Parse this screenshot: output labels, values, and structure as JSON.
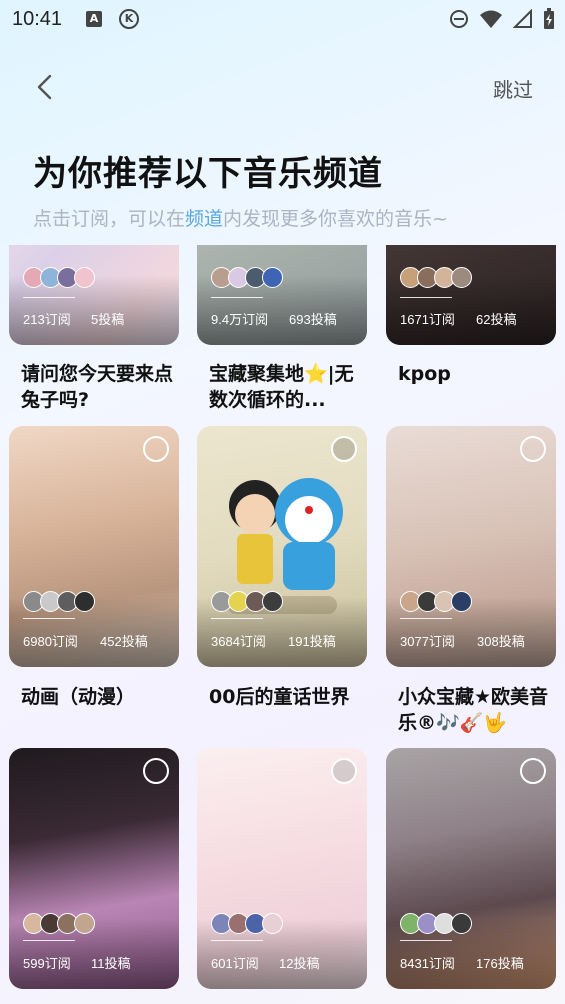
{
  "status": {
    "time": "10:41",
    "a_icon": "A",
    "k_icon": "K"
  },
  "header": {
    "skip_label": "跳过",
    "title": "为你推荐以下音乐频道",
    "subtitle_pre": "点击订阅，可以在",
    "subtitle_highlight": "频道",
    "subtitle_post": "内发现更多你喜欢的音乐~"
  },
  "cards": [
    {
      "subs": "213订阅",
      "posts": "5投稿",
      "name": "请问您今天要来点兔子吗?"
    },
    {
      "subs": "9.4万订阅",
      "posts": "693投稿",
      "name": "宝藏聚集地⭐|无数次循环的..."
    },
    {
      "subs": "1671订阅",
      "posts": "62投稿",
      "name": "kpop"
    },
    {
      "subs": "6980订阅",
      "posts": "452投稿",
      "name": "动画（动漫）"
    },
    {
      "subs": "3684订阅",
      "posts": "191投稿",
      "name": "00后的童话世界"
    },
    {
      "subs": "3077订阅",
      "posts": "308投稿",
      "name": "小众宝藏★欧美音乐®🎶🎸🤟"
    },
    {
      "subs": "599订阅",
      "posts": "11投稿",
      "name": ""
    },
    {
      "subs": "601订阅",
      "posts": "12投稿",
      "name": ""
    },
    {
      "subs": "8431订阅",
      "posts": "176投稿",
      "name": ""
    }
  ]
}
